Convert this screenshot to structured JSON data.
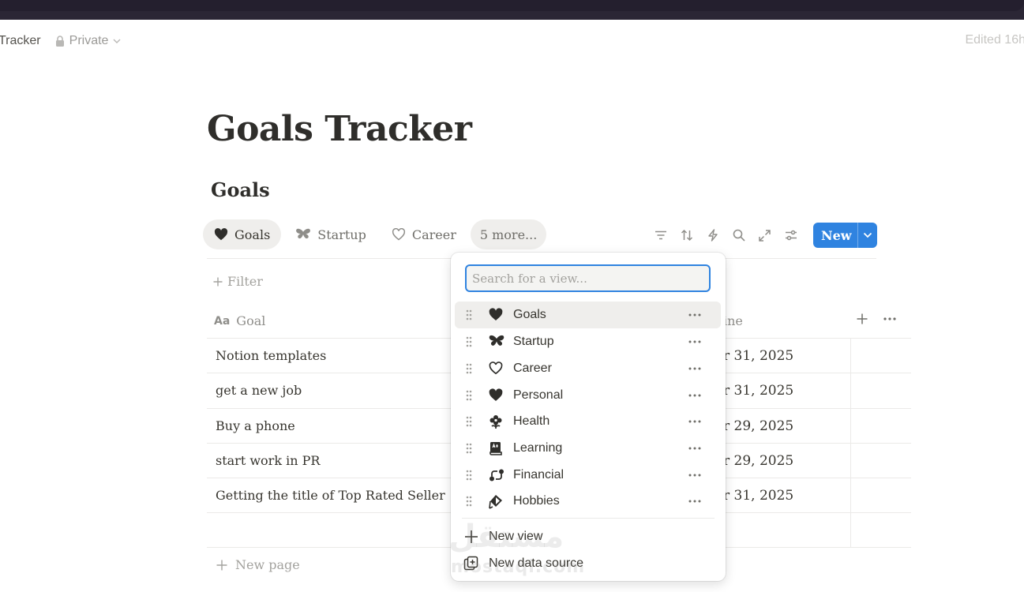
{
  "breadcrumb": {
    "title": "Tracker",
    "privacy": "Private"
  },
  "edited": "Edited 16h",
  "page_title": "Goals Tracker",
  "database": {
    "title": "Goals",
    "tabs": [
      {
        "label": "Goals",
        "icon": "heart-icon",
        "active": true
      },
      {
        "label": "Startup",
        "icon": "butterfly-icon",
        "active": false
      },
      {
        "label": "Career",
        "icon": "heart-outline-icon",
        "active": false
      },
      {
        "label": "5 more...",
        "icon": "",
        "active": false
      }
    ],
    "new_button": "New",
    "filter_label": "Filter",
    "columns": {
      "goal": "Goal",
      "goal_icon_text": "Aa",
      "deadline": "ine"
    },
    "rows": [
      {
        "goal": "Notion templates",
        "deadline": "r 31, 2025"
      },
      {
        "goal": "get a new job",
        "deadline": "r 31, 2025"
      },
      {
        "goal": "Buy a phone",
        "deadline": "r 29, 2025"
      },
      {
        "goal": "start work in PR",
        "deadline": "r 29, 2025"
      },
      {
        "goal": "Getting the title of Top Rated Seller",
        "deadline": "r 31, 2025"
      }
    ],
    "new_page": "New page"
  },
  "view_menu": {
    "search_placeholder": "Search for a view...",
    "views": [
      {
        "label": "Goals",
        "icon": "heart-icon"
      },
      {
        "label": "Startup",
        "icon": "butterfly-icon"
      },
      {
        "label": "Career",
        "icon": "heart-outline-icon"
      },
      {
        "label": "Personal",
        "icon": "heart-icon"
      },
      {
        "label": "Health",
        "icon": "flower-icon"
      },
      {
        "label": "Learning",
        "icon": "book-icon"
      },
      {
        "label": "Financial",
        "icon": "route-icon"
      },
      {
        "label": "Hobbies",
        "icon": "kite-icon"
      }
    ],
    "new_view": "New view",
    "new_data_source": "New data source"
  },
  "watermark": {
    "arabic": "مستقل",
    "latin": "mostaql.com"
  },
  "colors": {
    "accent": "#2f83e0",
    "titlebar": "#2b2635"
  }
}
